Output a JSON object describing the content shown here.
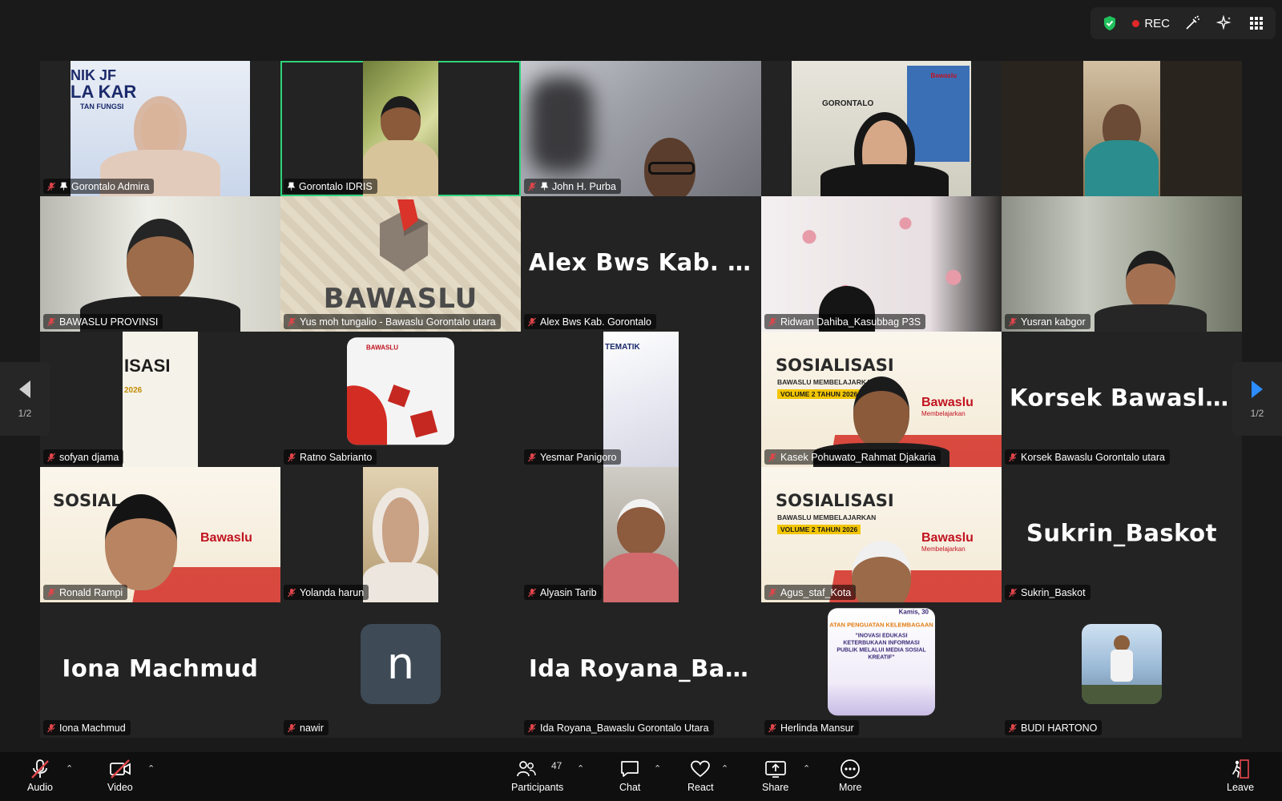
{
  "top_bar": {
    "rec_label": "REC"
  },
  "pager": {
    "left_label": "1/2",
    "right_label": "1/2"
  },
  "tiles": [
    {
      "name": "Gorontalo Admira"
    },
    {
      "name": "Gorontalo IDRIS"
    },
    {
      "name": "John H. Purba"
    },
    {
      "name": ""
    },
    {
      "name": ""
    },
    {
      "name": "BAWASLU PROVINSI"
    },
    {
      "name": "Yus moh tungalio - Bawaslu Gorontalo utara"
    },
    {
      "name": "Alex Bws Kab. Gorontalo",
      "display": "Alex Bws Kab. G..."
    },
    {
      "name": "Ridwan Dahiba_Kasubbag P3S"
    },
    {
      "name": "Yusran kabgor"
    },
    {
      "name": "sofyan djama"
    },
    {
      "name": "Ratno Sabrianto"
    },
    {
      "name": "Yesmar Panigoro"
    },
    {
      "name": "Kasek Pohuwato_Rahmat Djakaria"
    },
    {
      "name": "Korsek Bawaslu Gorontalo utara",
      "display": "Korsek Bawaslu..."
    },
    {
      "name": "Ronald Rampi"
    },
    {
      "name": "Yolanda harun"
    },
    {
      "name": "Alyasin Tarib"
    },
    {
      "name": "Agus_staf_Kota"
    },
    {
      "name": "Sukrin_Baskot",
      "display": "Sukrin_Baskot"
    },
    {
      "name": "Iona Machmud",
      "display": "Iona Machmud"
    },
    {
      "name": "nawir",
      "display": "n"
    },
    {
      "name": "Ida Royana_Bawaslu Gorontalo Utara",
      "display": "Ida Royana_Baw..."
    },
    {
      "name": "Herlinda Mansur"
    },
    {
      "name": "BUDI HARTONO"
    }
  ],
  "scene_text": {
    "bawaslu": "BAWASLU",
    "gorontalo": "GORONTALO",
    "sosialisasi": "SOSIALISASI",
    "membelajarkan": "BAWASLU MEMBELAJARKAN",
    "volume": "VOLUME 2 TAHUN 2026",
    "bawaslu_brand": "Bawaslu",
    "brand_sub": "Membelajarkan",
    "tematik": "TEMATIK",
    "isasi": "ISASI",
    "tahun": "2026",
    "sosial_short": "SOSIAL",
    "herlinda_line1": "ATAN PENGUATAN KELEMBAGAAN",
    "herlinda_line2": "\"INOVASI EDUKASI KETERBUKAAN INFORMASI PUBLIK MELALUI MEDIA SOSIAL KREATIF\"",
    "kamis": "Kamis, 30",
    "nik": "NIK JF",
    "la_kar": "LA KAR",
    "tan_fungsi": "TAN FUNGSI"
  },
  "toolbar": {
    "audio": "Audio",
    "video": "Video",
    "participants": "Participants",
    "participants_count": "47",
    "chat": "Chat",
    "react": "React",
    "share": "Share",
    "more": "More",
    "leave": "Leave"
  },
  "colors": {
    "active_speaker": "#2fd37b",
    "rec_dot": "#e02828",
    "toolbar_bg": "#0f0f0f",
    "mute_red": "#e0454b"
  }
}
